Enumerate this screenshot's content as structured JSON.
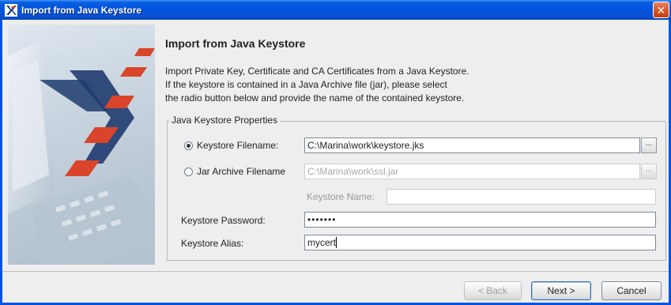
{
  "window": {
    "title": "Import from Java Keystore",
    "close_glyph": "✕"
  },
  "page": {
    "heading": "Import from Java Keystore",
    "description": [
      "Import Private Key, Certificate and CA Certificates from a Java Keystore.",
      "If the keystore is contained in a Java Archive file (jar), please select",
      "the radio button below and provide the name of the contained keystore."
    ]
  },
  "group": {
    "legend": "Java Keystore Properties",
    "keystore_filename_label": "Keystore Filename:",
    "keystore_filename_value": "C:\\Marina\\work\\keystore.jks",
    "jar_filename_label": "Jar Archive Filename",
    "jar_filename_value": "C:\\Marina\\work\\ssl.jar",
    "keystore_name_label": "Keystore Name:",
    "keystore_name_value": "",
    "password_label": "Keystore Password:",
    "password_value": "•••••••",
    "alias_label": "Keystore Alias:",
    "alias_value": "mycert",
    "browse_label": "...",
    "selected_source": "keystore"
  },
  "buttons": {
    "back": "< Back",
    "next": "Next >",
    "cancel": "Cancel"
  },
  "icons": {
    "app": "oracle-x-logo-icon",
    "close": "close-icon"
  },
  "colors": {
    "titlebar": "#0054e3",
    "accent_red": "#d9442a",
    "logo_blue": "#1f3b6f"
  }
}
